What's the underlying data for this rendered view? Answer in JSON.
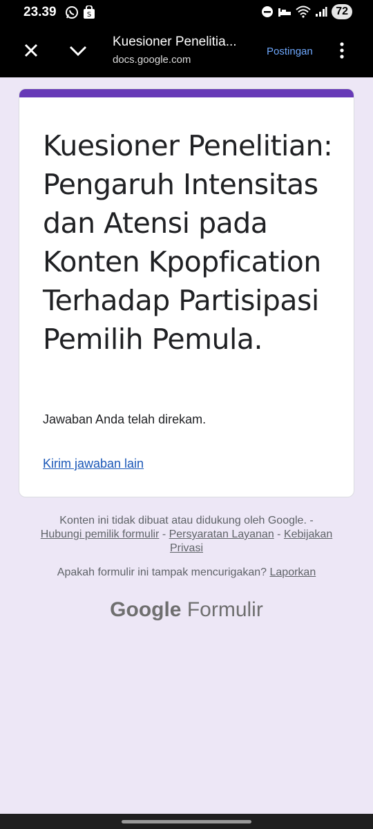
{
  "status_bar": {
    "time": "23.39",
    "battery": "72",
    "icons": [
      "whatsapp-icon",
      "shopping-bag-icon",
      "do-not-disturb-icon",
      "sleep-icon",
      "wifi-icon",
      "signal-icon"
    ]
  },
  "toolbar": {
    "title": "Kuesioner Penelitia...",
    "url": "docs.google.com",
    "action_label": "Postingan"
  },
  "card": {
    "accent_color": "#673ab7",
    "title": "Kuesioner Penelitian: Pengaruh Intensitas dan Atensi pada Konten Kpopfication Terhadap Partisipasi Pemilih Pemula.",
    "message": "Jawaban Anda telah direkam.",
    "link_label": "Kirim jawaban lain"
  },
  "footer": {
    "notice_text": "Konten ini tidak dibuat atau didukung oleh Google.",
    "sep1": " - ",
    "contact_owner": "Hubungi pemilik formulir",
    "sep2": " - ",
    "terms": "Persyaratan Layanan",
    "sep3": " - ",
    "privacy": "Kebijakan Privasi",
    "suspicious_question": "Apakah formulir ini tampak mencurigakan?",
    "report": "Laporkan",
    "brand_google": "Google",
    "brand_product": "Formulir"
  },
  "colors": {
    "page_background": "#ede7f6",
    "link": "#1a57b7",
    "toolbar_action": "#6ea8fe"
  }
}
